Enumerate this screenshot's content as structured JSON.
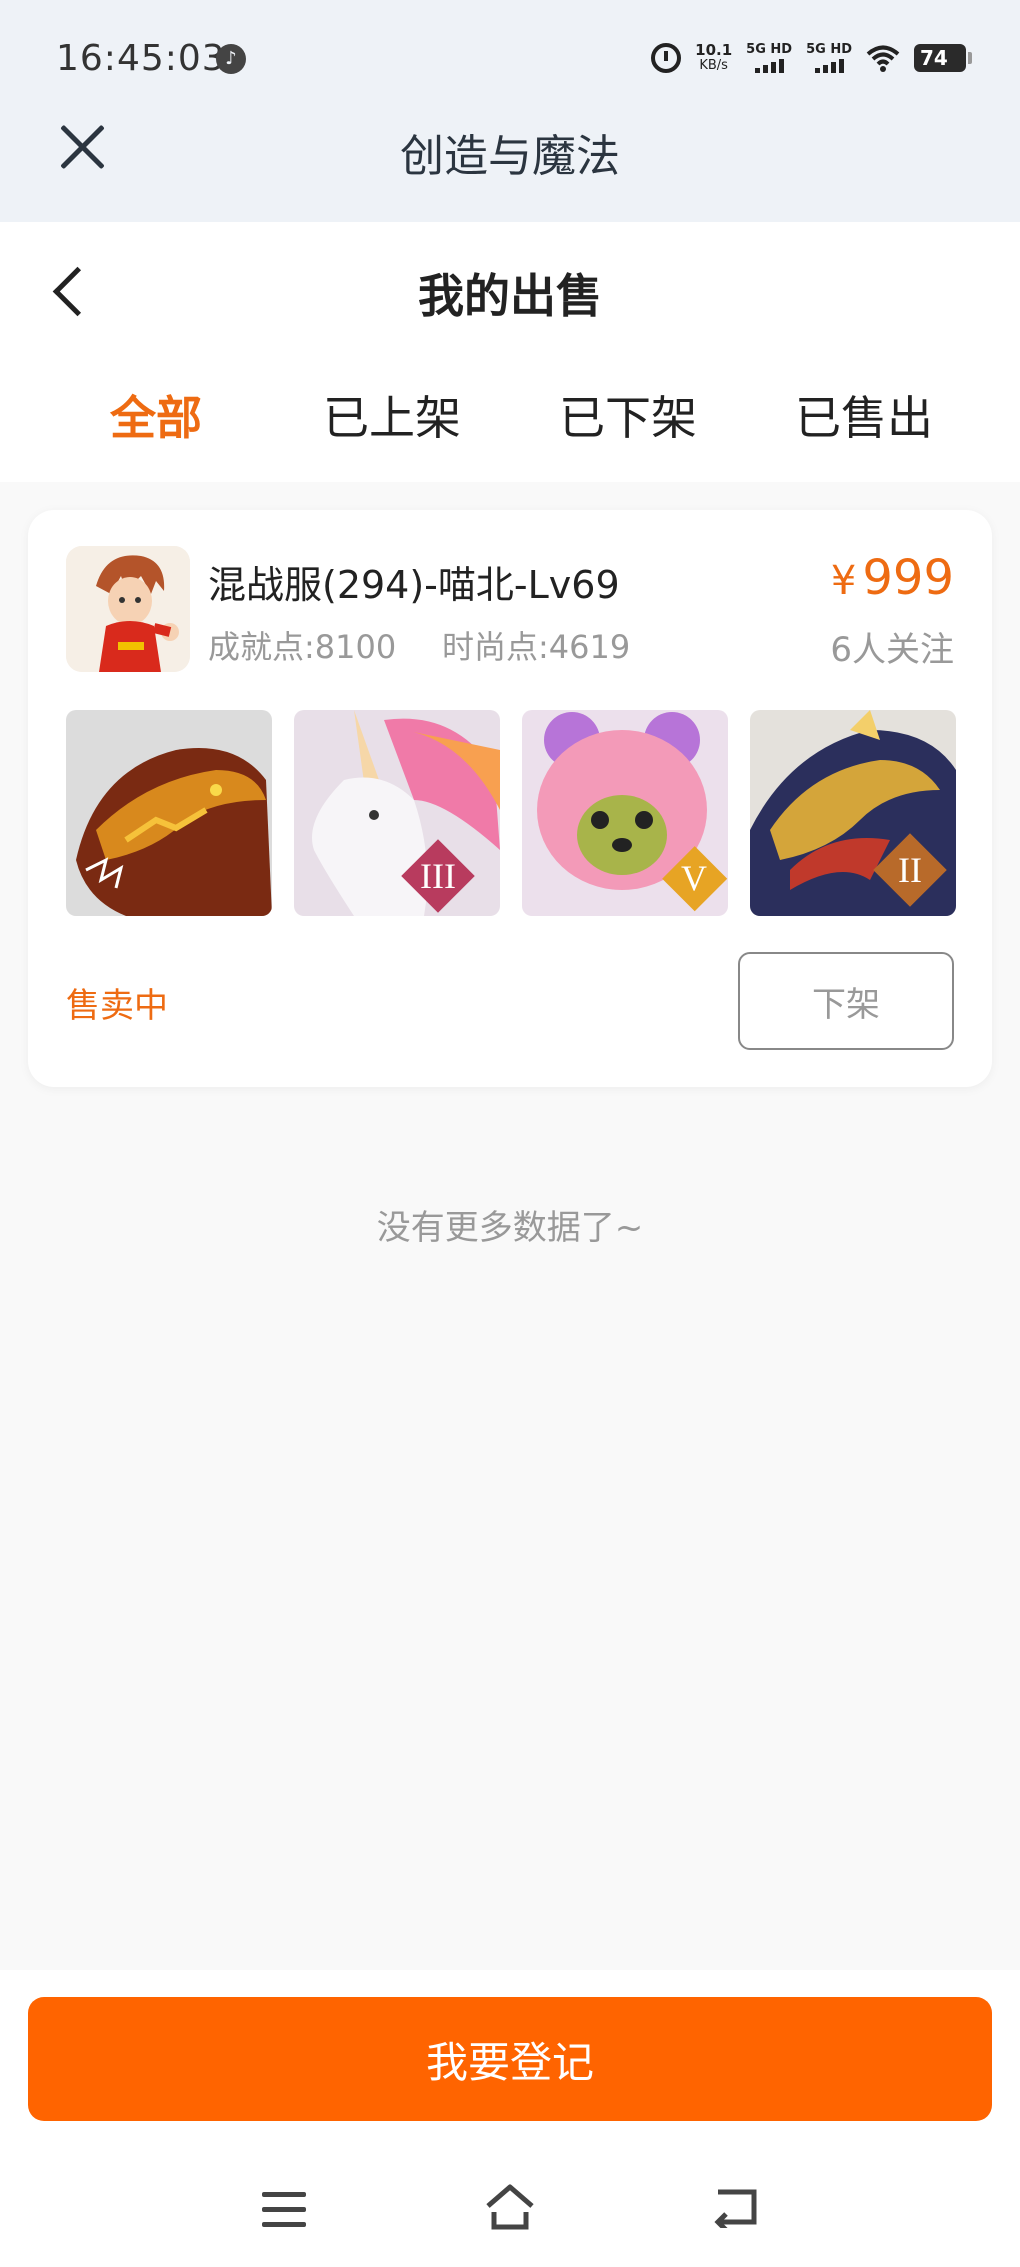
{
  "status_bar": {
    "time": "16:45:03",
    "net_speed_value": "10.1",
    "net_speed_unit": "KB/s",
    "sim1": "5G HD",
    "sim2": "5G HD",
    "battery": "74"
  },
  "app_bar": {
    "title": "创造与魔法"
  },
  "page": {
    "title": "我的出售",
    "tabs": [
      {
        "label": "全部",
        "active": true
      },
      {
        "label": "已上架",
        "active": false
      },
      {
        "label": "已下架",
        "active": false
      },
      {
        "label": "已售出",
        "active": false
      }
    ]
  },
  "listing": {
    "title": "混战服(294)-喵北-Lv69",
    "achievement": "成就点:8100",
    "fashion": "时尚点:4619",
    "price_symbol": "¥",
    "price": "999",
    "followers": "6人关注",
    "thumbs": [
      {
        "name": "fire-dragon-mount",
        "badge": ""
      },
      {
        "name": "unicorn-mount",
        "badge": "III"
      },
      {
        "name": "pink-bear-pet",
        "badge": "V"
      },
      {
        "name": "golden-dragon-mount",
        "badge": "II"
      }
    ],
    "status": "售卖中",
    "delist_label": "下架"
  },
  "footer_note": "没有更多数据了~",
  "register_button": "我要登记",
  "colors": {
    "accent": "#ee6b12",
    "button": "#ff6400"
  }
}
